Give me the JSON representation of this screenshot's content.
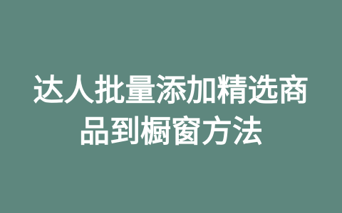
{
  "title": {
    "line1": "达人批量添加精选商",
    "line2": "品到橱窗方法"
  },
  "colors": {
    "background": "#5e877e",
    "text": "#ffffff"
  }
}
